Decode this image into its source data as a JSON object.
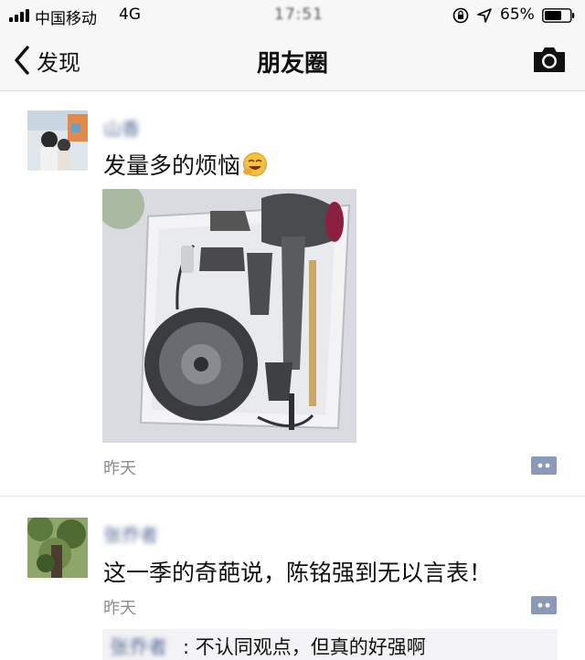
{
  "status_bar": {
    "carrier": "中国移动",
    "network": "4G",
    "time": "17:51",
    "battery": "65%",
    "icons": [
      "signal-icon",
      "orientation-lock-icon",
      "location-icon",
      "battery-icon"
    ]
  },
  "nav": {
    "back_label": "发现",
    "title": "朋友圈",
    "icons": [
      "back-chevron-icon",
      "camera-icon"
    ]
  },
  "posts": [
    {
      "username": "山香",
      "text": "发量多的烦恼",
      "emoji": "crying-laughing-emoji",
      "timestamp": "昨天",
      "has_photo": true
    },
    {
      "username": "张乔者",
      "text": "这一季的奇葩说，陈铭强到无以言表！",
      "timestamp": "昨天",
      "comments": [
        {
          "author": "张乔者",
          "separator": ": ",
          "text": "不认同观点，但真的好强啊"
        }
      ]
    }
  ],
  "colors": {
    "link_blue": "#576b95",
    "nav_bg": "#f7f7f7",
    "comment_bg": "#f3f3f5",
    "comment_icon": "#8a9ab8"
  }
}
